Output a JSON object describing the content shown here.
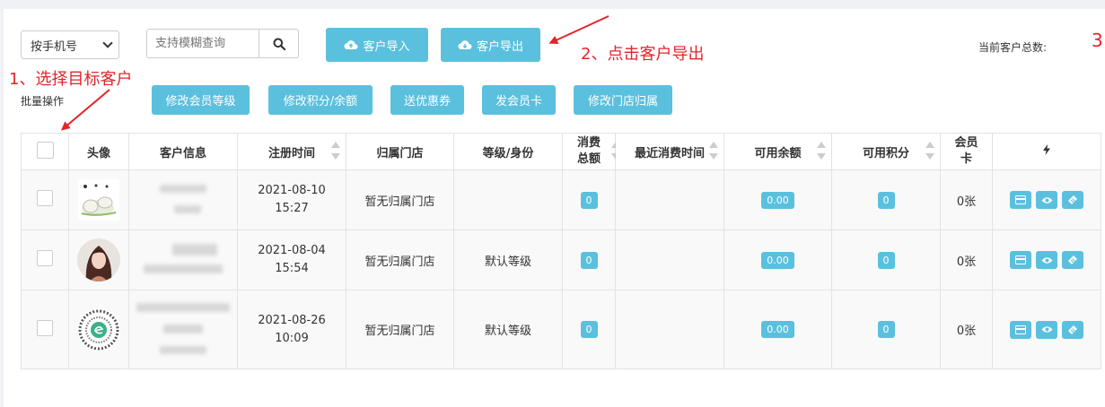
{
  "toolbar": {
    "select_value": "按手机号",
    "search_placeholder": "支持模糊查询",
    "import_label": "客户导入",
    "export_label": "客户导出",
    "total_label": "当前客户总数:",
    "total_value": "3"
  },
  "annotations": {
    "step1": "1、选择目标客户",
    "step2": "2、点击客户导出"
  },
  "batch": {
    "label": "批量操作",
    "buttons": [
      "修改会员等级",
      "修改积分/余额",
      "送优惠券",
      "发会员卡",
      "修改门店归属"
    ]
  },
  "table": {
    "headers": {
      "avatar": "头像",
      "info": "客户信息",
      "reg_time": "注册时间",
      "store": "归属门店",
      "level": "等级/身份",
      "spent_line1": "消费",
      "spent_line2": "总额",
      "last_time": "最近消费时间",
      "balance": "可用余额",
      "points": "可用积分",
      "card_line1": "会员",
      "card_line2": "卡",
      "ops_icon": "lightning-icon"
    },
    "rows": [
      {
        "date": "2021-08-10",
        "time": "15:27",
        "store": "暂无归属门店",
        "level": "",
        "spent": "0",
        "balance": "0.00",
        "points": "0",
        "card": "0张"
      },
      {
        "date": "2021-08-04",
        "time": "15:54",
        "store": "暂无归属门店",
        "level": "默认等级",
        "spent": "0",
        "balance": "0.00",
        "points": "0",
        "card": "0张"
      },
      {
        "date": "2021-08-26",
        "time": "10:09",
        "store": "暂无归属门店",
        "level": "默认等级",
        "spent": "0",
        "balance": "0.00",
        "points": "0",
        "card": "0张"
      }
    ]
  },
  "colors": {
    "accent": "#5bc0de",
    "annotation": "#e3242b"
  }
}
